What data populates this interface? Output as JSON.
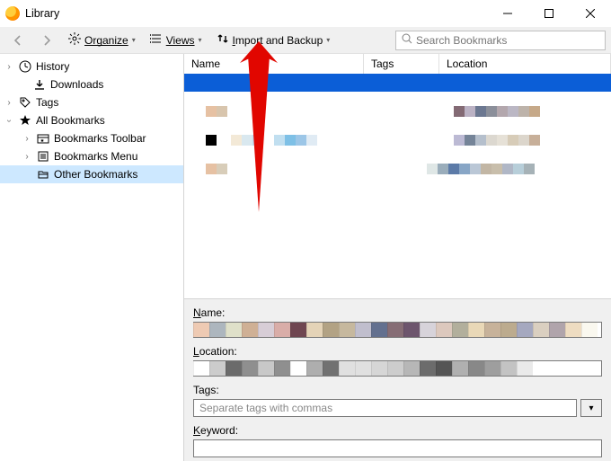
{
  "window": {
    "title": "Library"
  },
  "toolbar": {
    "organize": "Organize",
    "views": "Views",
    "import": "Import and Backup"
  },
  "search": {
    "placeholder": "Search Bookmarks"
  },
  "sidebar": {
    "items": [
      {
        "label": "History"
      },
      {
        "label": "Downloads"
      },
      {
        "label": "Tags"
      },
      {
        "label": "All Bookmarks"
      },
      {
        "label": "Bookmarks Toolbar"
      },
      {
        "label": "Bookmarks Menu"
      },
      {
        "label": "Other Bookmarks"
      }
    ]
  },
  "columns": {
    "name": "Name",
    "tags": "Tags",
    "location": "Location"
  },
  "details": {
    "name_label": "Name:",
    "location_label": "Location:",
    "tags_label": "Tags:",
    "tags_placeholder": "Separate tags with commas",
    "keyword_label": "Keyword:"
  },
  "name_colors": [
    "#eecab3",
    "#adb6be",
    "#dfe0c9",
    "#cfb095",
    "#d7cdd6",
    "#d9ada8",
    "#6f4651",
    "#e4d3b7",
    "#b2a284",
    "#c6b89e",
    "#c0becd",
    "#63708f",
    "#866d75",
    "#6d556d",
    "#d7d3da",
    "#dcc8bd",
    "#b2af9c",
    "#e9d8b7",
    "#c7b29a",
    "#bcab8e",
    "#a5a8bf",
    "#dacfc0",
    "#b0a4ab",
    "#eedcc1",
    "#faf8ef"
  ],
  "loc_colors": [
    "#ffffff",
    "#cccccc",
    "#6b6b6b",
    "#8f8f8f",
    "#c8c8c8",
    "#8f8f8f",
    "#ffffff",
    "#aeaeae",
    "#717171",
    "#e0e0e0",
    "#e0e0e0",
    "#d6d6d6",
    "#cdcdcd",
    "#b7b7b7",
    "#6c6c6c",
    "#555555",
    "#b0b0b0",
    "#888888",
    "#9e9e9e",
    "#c3c3c3",
    "#eaeaea"
  ],
  "rows": [
    {
      "name": [
        "#e6c1a3",
        "#d8c5ad"
      ],
      "tags": [],
      "loc": [
        "#836a74",
        "#bbb2c4",
        "#6c7891",
        "#8b8f9a",
        "#b3a7ad",
        "#bbb7c4",
        "#bdb3aa",
        "#c6a989"
      ]
    },
    {
      "name_icon": "#000000",
      "name": [
        "#f3e9d7",
        "#d9e8ef",
        "#c1dff0",
        "#ffffff",
        "#c1dff0",
        "#7ec0e6",
        "#9cc6e7",
        "#e0ebf4"
      ],
      "tags": [],
      "loc": [
        "#bcbad4",
        "#758498",
        "#b5bfcc",
        "#dcd8d0",
        "#e6e1d7",
        "#d7ccb8",
        "#dcd6cc",
        "#c7af99"
      ]
    },
    {
      "name": [
        "#e6c1a3",
        "#d8cdb9"
      ],
      "tags": [],
      "loc": [
        "#dfe7e6",
        "#9aadbb",
        "#5c7ba8",
        "#88a6c6",
        "#bac7d6",
        "#c2b6a4",
        "#c8beab",
        "#b0b7c6",
        "#b7ced9",
        "#a6b2b7"
      ]
    }
  ]
}
